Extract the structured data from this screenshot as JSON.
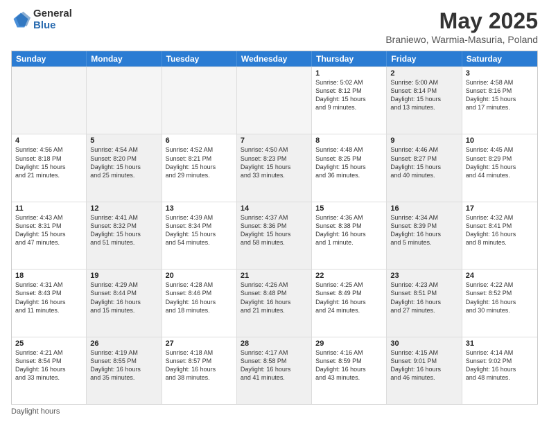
{
  "logo": {
    "general": "General",
    "blue": "Blue"
  },
  "header": {
    "month": "May 2025",
    "location": "Braniewo, Warmia-Masuria, Poland"
  },
  "weekdays": [
    "Sunday",
    "Monday",
    "Tuesday",
    "Wednesday",
    "Thursday",
    "Friday",
    "Saturday"
  ],
  "footer": {
    "daylight_label": "Daylight hours"
  },
  "weeks": [
    [
      {
        "day": "",
        "info": "",
        "empty": true
      },
      {
        "day": "",
        "info": "",
        "empty": true
      },
      {
        "day": "",
        "info": "",
        "empty": true
      },
      {
        "day": "",
        "info": "",
        "empty": true
      },
      {
        "day": "1",
        "info": "Sunrise: 5:02 AM\nSunset: 8:12 PM\nDaylight: 15 hours\nand 9 minutes.",
        "shaded": false
      },
      {
        "day": "2",
        "info": "Sunrise: 5:00 AM\nSunset: 8:14 PM\nDaylight: 15 hours\nand 13 minutes.",
        "shaded": true
      },
      {
        "day": "3",
        "info": "Sunrise: 4:58 AM\nSunset: 8:16 PM\nDaylight: 15 hours\nand 17 minutes.",
        "shaded": false
      }
    ],
    [
      {
        "day": "4",
        "info": "Sunrise: 4:56 AM\nSunset: 8:18 PM\nDaylight: 15 hours\nand 21 minutes.",
        "shaded": false
      },
      {
        "day": "5",
        "info": "Sunrise: 4:54 AM\nSunset: 8:20 PM\nDaylight: 15 hours\nand 25 minutes.",
        "shaded": true
      },
      {
        "day": "6",
        "info": "Sunrise: 4:52 AM\nSunset: 8:21 PM\nDaylight: 15 hours\nand 29 minutes.",
        "shaded": false
      },
      {
        "day": "7",
        "info": "Sunrise: 4:50 AM\nSunset: 8:23 PM\nDaylight: 15 hours\nand 33 minutes.",
        "shaded": true
      },
      {
        "day": "8",
        "info": "Sunrise: 4:48 AM\nSunset: 8:25 PM\nDaylight: 15 hours\nand 36 minutes.",
        "shaded": false
      },
      {
        "day": "9",
        "info": "Sunrise: 4:46 AM\nSunset: 8:27 PM\nDaylight: 15 hours\nand 40 minutes.",
        "shaded": true
      },
      {
        "day": "10",
        "info": "Sunrise: 4:45 AM\nSunset: 8:29 PM\nDaylight: 15 hours\nand 44 minutes.",
        "shaded": false
      }
    ],
    [
      {
        "day": "11",
        "info": "Sunrise: 4:43 AM\nSunset: 8:31 PM\nDaylight: 15 hours\nand 47 minutes.",
        "shaded": false
      },
      {
        "day": "12",
        "info": "Sunrise: 4:41 AM\nSunset: 8:32 PM\nDaylight: 15 hours\nand 51 minutes.",
        "shaded": true
      },
      {
        "day": "13",
        "info": "Sunrise: 4:39 AM\nSunset: 8:34 PM\nDaylight: 15 hours\nand 54 minutes.",
        "shaded": false
      },
      {
        "day": "14",
        "info": "Sunrise: 4:37 AM\nSunset: 8:36 PM\nDaylight: 15 hours\nand 58 minutes.",
        "shaded": true
      },
      {
        "day": "15",
        "info": "Sunrise: 4:36 AM\nSunset: 8:38 PM\nDaylight: 16 hours\nand 1 minute.",
        "shaded": false
      },
      {
        "day": "16",
        "info": "Sunrise: 4:34 AM\nSunset: 8:39 PM\nDaylight: 16 hours\nand 5 minutes.",
        "shaded": true
      },
      {
        "day": "17",
        "info": "Sunrise: 4:32 AM\nSunset: 8:41 PM\nDaylight: 16 hours\nand 8 minutes.",
        "shaded": false
      }
    ],
    [
      {
        "day": "18",
        "info": "Sunrise: 4:31 AM\nSunset: 8:43 PM\nDaylight: 16 hours\nand 11 minutes.",
        "shaded": false
      },
      {
        "day": "19",
        "info": "Sunrise: 4:29 AM\nSunset: 8:44 PM\nDaylight: 16 hours\nand 15 minutes.",
        "shaded": true
      },
      {
        "day": "20",
        "info": "Sunrise: 4:28 AM\nSunset: 8:46 PM\nDaylight: 16 hours\nand 18 minutes.",
        "shaded": false
      },
      {
        "day": "21",
        "info": "Sunrise: 4:26 AM\nSunset: 8:48 PM\nDaylight: 16 hours\nand 21 minutes.",
        "shaded": true
      },
      {
        "day": "22",
        "info": "Sunrise: 4:25 AM\nSunset: 8:49 PM\nDaylight: 16 hours\nand 24 minutes.",
        "shaded": false
      },
      {
        "day": "23",
        "info": "Sunrise: 4:23 AM\nSunset: 8:51 PM\nDaylight: 16 hours\nand 27 minutes.",
        "shaded": true
      },
      {
        "day": "24",
        "info": "Sunrise: 4:22 AM\nSunset: 8:52 PM\nDaylight: 16 hours\nand 30 minutes.",
        "shaded": false
      }
    ],
    [
      {
        "day": "25",
        "info": "Sunrise: 4:21 AM\nSunset: 8:54 PM\nDaylight: 16 hours\nand 33 minutes.",
        "shaded": false
      },
      {
        "day": "26",
        "info": "Sunrise: 4:19 AM\nSunset: 8:55 PM\nDaylight: 16 hours\nand 35 minutes.",
        "shaded": true
      },
      {
        "day": "27",
        "info": "Sunrise: 4:18 AM\nSunset: 8:57 PM\nDaylight: 16 hours\nand 38 minutes.",
        "shaded": false
      },
      {
        "day": "28",
        "info": "Sunrise: 4:17 AM\nSunset: 8:58 PM\nDaylight: 16 hours\nand 41 minutes.",
        "shaded": true
      },
      {
        "day": "29",
        "info": "Sunrise: 4:16 AM\nSunset: 8:59 PM\nDaylight: 16 hours\nand 43 minutes.",
        "shaded": false
      },
      {
        "day": "30",
        "info": "Sunrise: 4:15 AM\nSunset: 9:01 PM\nDaylight: 16 hours\nand 46 minutes.",
        "shaded": true
      },
      {
        "day": "31",
        "info": "Sunrise: 4:14 AM\nSunset: 9:02 PM\nDaylight: 16 hours\nand 48 minutes.",
        "shaded": false
      }
    ]
  ]
}
